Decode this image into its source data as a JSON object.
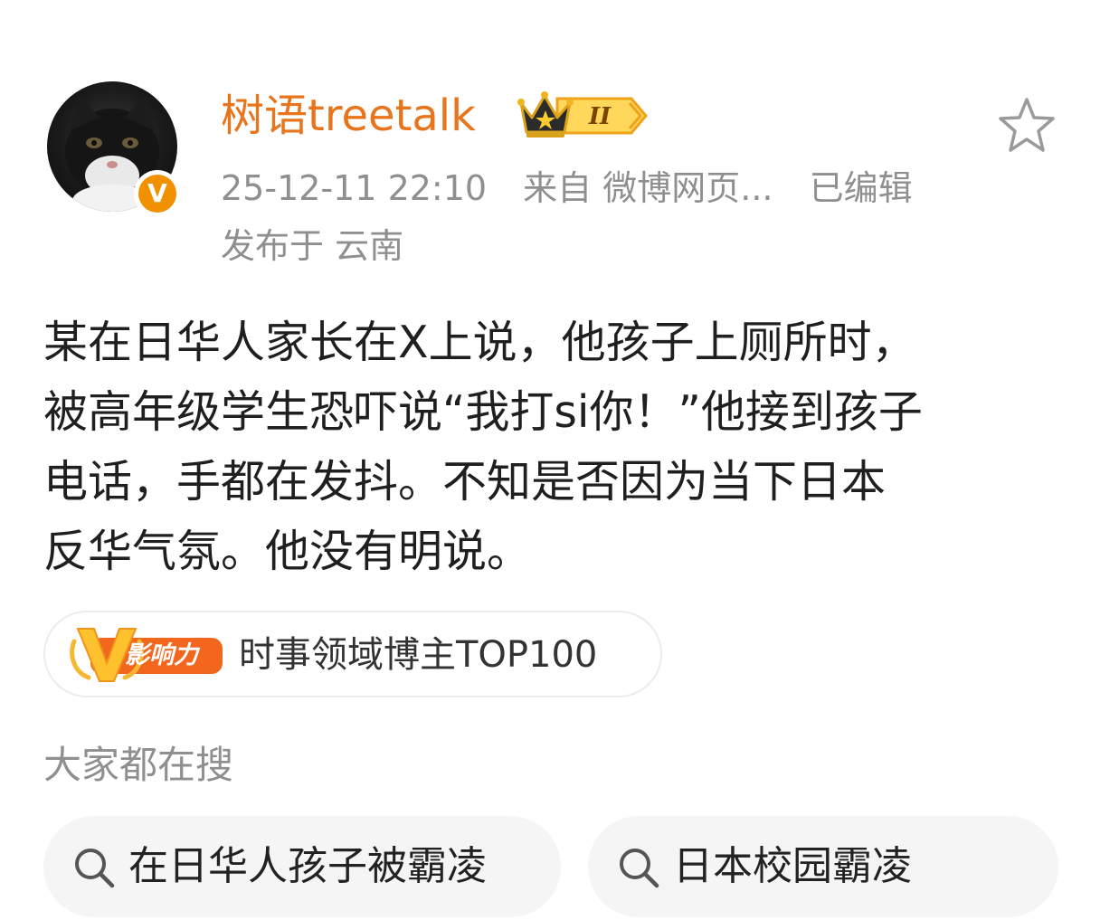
{
  "post": {
    "author": {
      "name": "树语treetalk",
      "member_level": "II",
      "verified_mark": "V"
    },
    "meta": {
      "timestamp": "25-12-11 22:10",
      "source": "来自 微博网页...",
      "edited": "已编辑",
      "location": "发布于 云南"
    },
    "content_lines": [
      "某在日华人家长在X上说，他孩子上厕所时，",
      "被高年级学生恐吓说“我打si你！”他接到孩子",
      "电话，手都在发抖。不知是否因为当下日本",
      "反华气氛。他没有明说。"
    ],
    "influence": {
      "badge_mark": "V",
      "badge_label": "影响力",
      "text": "时事领域博主TOP100"
    }
  },
  "search": {
    "heading": "大家都在搜",
    "chips": [
      {
        "label": "在日华人孩子被霸凌",
        "icon": "search-icon"
      },
      {
        "label": "日本校园霸凌",
        "icon": "search-icon"
      }
    ]
  },
  "colors": {
    "username": "#e8741c",
    "meta": "#8f8f8f",
    "verified": "#f29100",
    "chip_background": "#f5f5f5"
  }
}
